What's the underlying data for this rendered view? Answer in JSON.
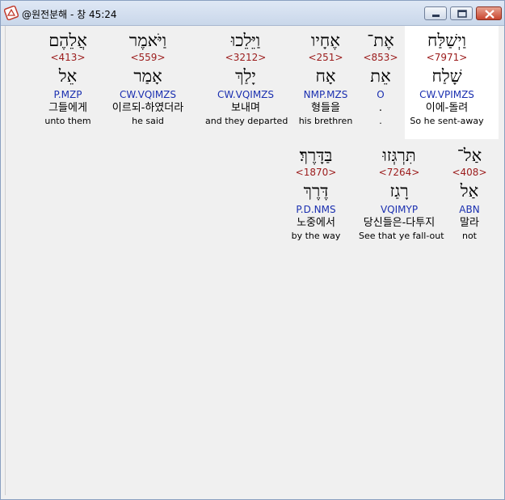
{
  "window": {
    "title": "@원전분해 - 창 45:24",
    "colors": {
      "strong": "#9b1b1b",
      "parse": "#1a2fb0",
      "selected_bg": "#ffffff"
    }
  },
  "verse_words": [
    {
      "hebrew": "וַיְשַׁלַּח",
      "strong": "<7971>",
      "lemma": "שָׁלַח",
      "parse": "CW.VPIMZS",
      "korean": "이에-돌려",
      "english": "So he sent-away",
      "selected": true
    },
    {
      "hebrew": "אֶת־",
      "strong": "<853>",
      "lemma": "אֵת",
      "parse": "O",
      "korean": ".",
      "english": "."
    },
    {
      "hebrew": "אֶחָיו",
      "strong": "<251>",
      "lemma": "אָח",
      "parse": "NMP.MZS",
      "korean": "형들을",
      "english": "his brethren"
    },
    {
      "hebrew": "וַיֵּלֵכוּ",
      "strong": "<3212>",
      "lemma": "יָלַךְ",
      "parse": "CW.VQIMZS",
      "korean": "보내며",
      "english": "and they departed"
    },
    {
      "hebrew": "וַיֹּאמֶר",
      "strong": "<559>",
      "lemma": "אָמַר",
      "parse": "CW.VQIMZS",
      "korean": "이르되-하였더라",
      "english": "he said"
    },
    {
      "hebrew": "אֲלֵהֶם",
      "strong": "<413>",
      "lemma": "אֵל",
      "parse": "P.MZP",
      "korean": "그들에게",
      "english": "unto them"
    },
    {
      "hebrew": "אַל־",
      "strong": "<408>",
      "lemma": "אַל",
      "parse": "ABN",
      "korean": "말라",
      "english": "not"
    },
    {
      "hebrew": "תִּרְגְּזוּ",
      "strong": "<7264>",
      "lemma": "רָגַז",
      "parse": "VQIMYP",
      "korean": "당신들은-다투지",
      "english": "See that ye fall-out"
    },
    {
      "hebrew": "בַּדָּרֶךְ׃",
      "strong": "<1870>",
      "lemma": "דֶּרֶךְ",
      "parse": "P.D.NMS",
      "korean": "노중에서",
      "english": "by the way"
    }
  ]
}
